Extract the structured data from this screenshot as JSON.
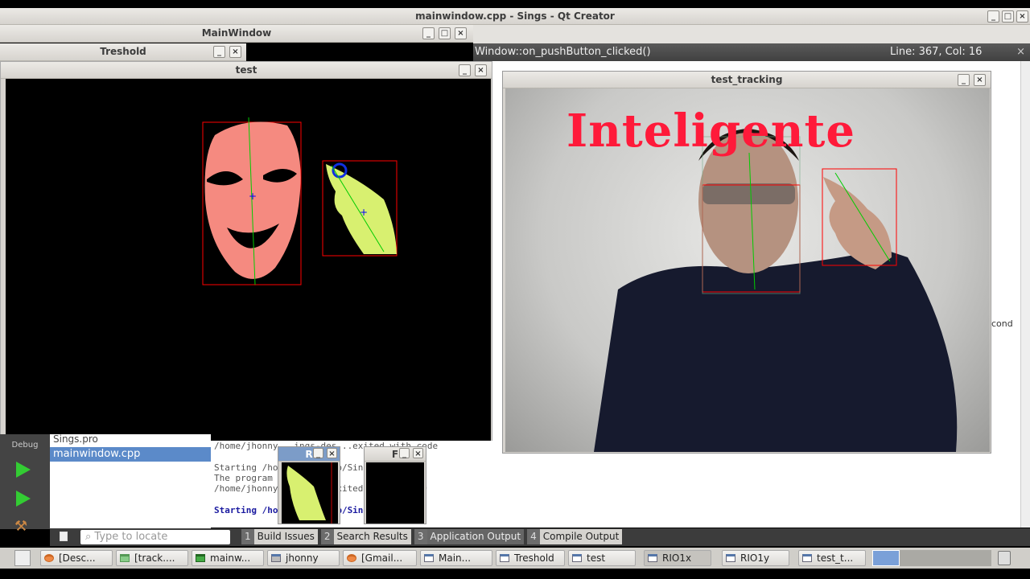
{
  "qtcreator": {
    "title": "mainwindow.cpp - Sings - Qt Creator",
    "function": "Window::on_pushButton_clicked()",
    "position": "Line: 367, Col: 16",
    "sidebar_mode": "Debug",
    "project_files": [
      "Sings.pro",
      "mainwindow.cpp"
    ],
    "locate_placeholder": "Type to locate",
    "right_snippet": "cond",
    "output_lines": [
      "/home/jhonny...ings-des...exited with code",
      "Starting /ho...ings-...p/Sings...",
      "The program ...edly",
      "/home/jhonny...-des...exited with code 0",
      "Starting /ho...ings-...p/Sings..."
    ],
    "panes": [
      {
        "n": "1",
        "label": "Build Issues"
      },
      {
        "n": "2",
        "label": "Search Results"
      },
      {
        "n": "3",
        "label": "Application Output"
      },
      {
        "n": "4",
        "label": "Compile Output"
      }
    ]
  },
  "windows": {
    "mainwindow": "MainWindow",
    "treshold": "Treshold",
    "test": "test",
    "test_tracking": "test_tracking",
    "small_r": "R",
    "small_f": "F"
  },
  "overlay_text": "Inteligente",
  "taskbar": [
    "[Desc...",
    "[track....",
    "mainw...",
    "jhonny",
    "[Gmail...",
    "Main...",
    "Treshold",
    "test",
    "RIO1x",
    "RIO1y",
    "test_t..."
  ],
  "colors": {
    "overlay": "#ff1a3a",
    "face": "#f58a80",
    "hand": "#d8f070",
    "box": "#ff0000"
  }
}
